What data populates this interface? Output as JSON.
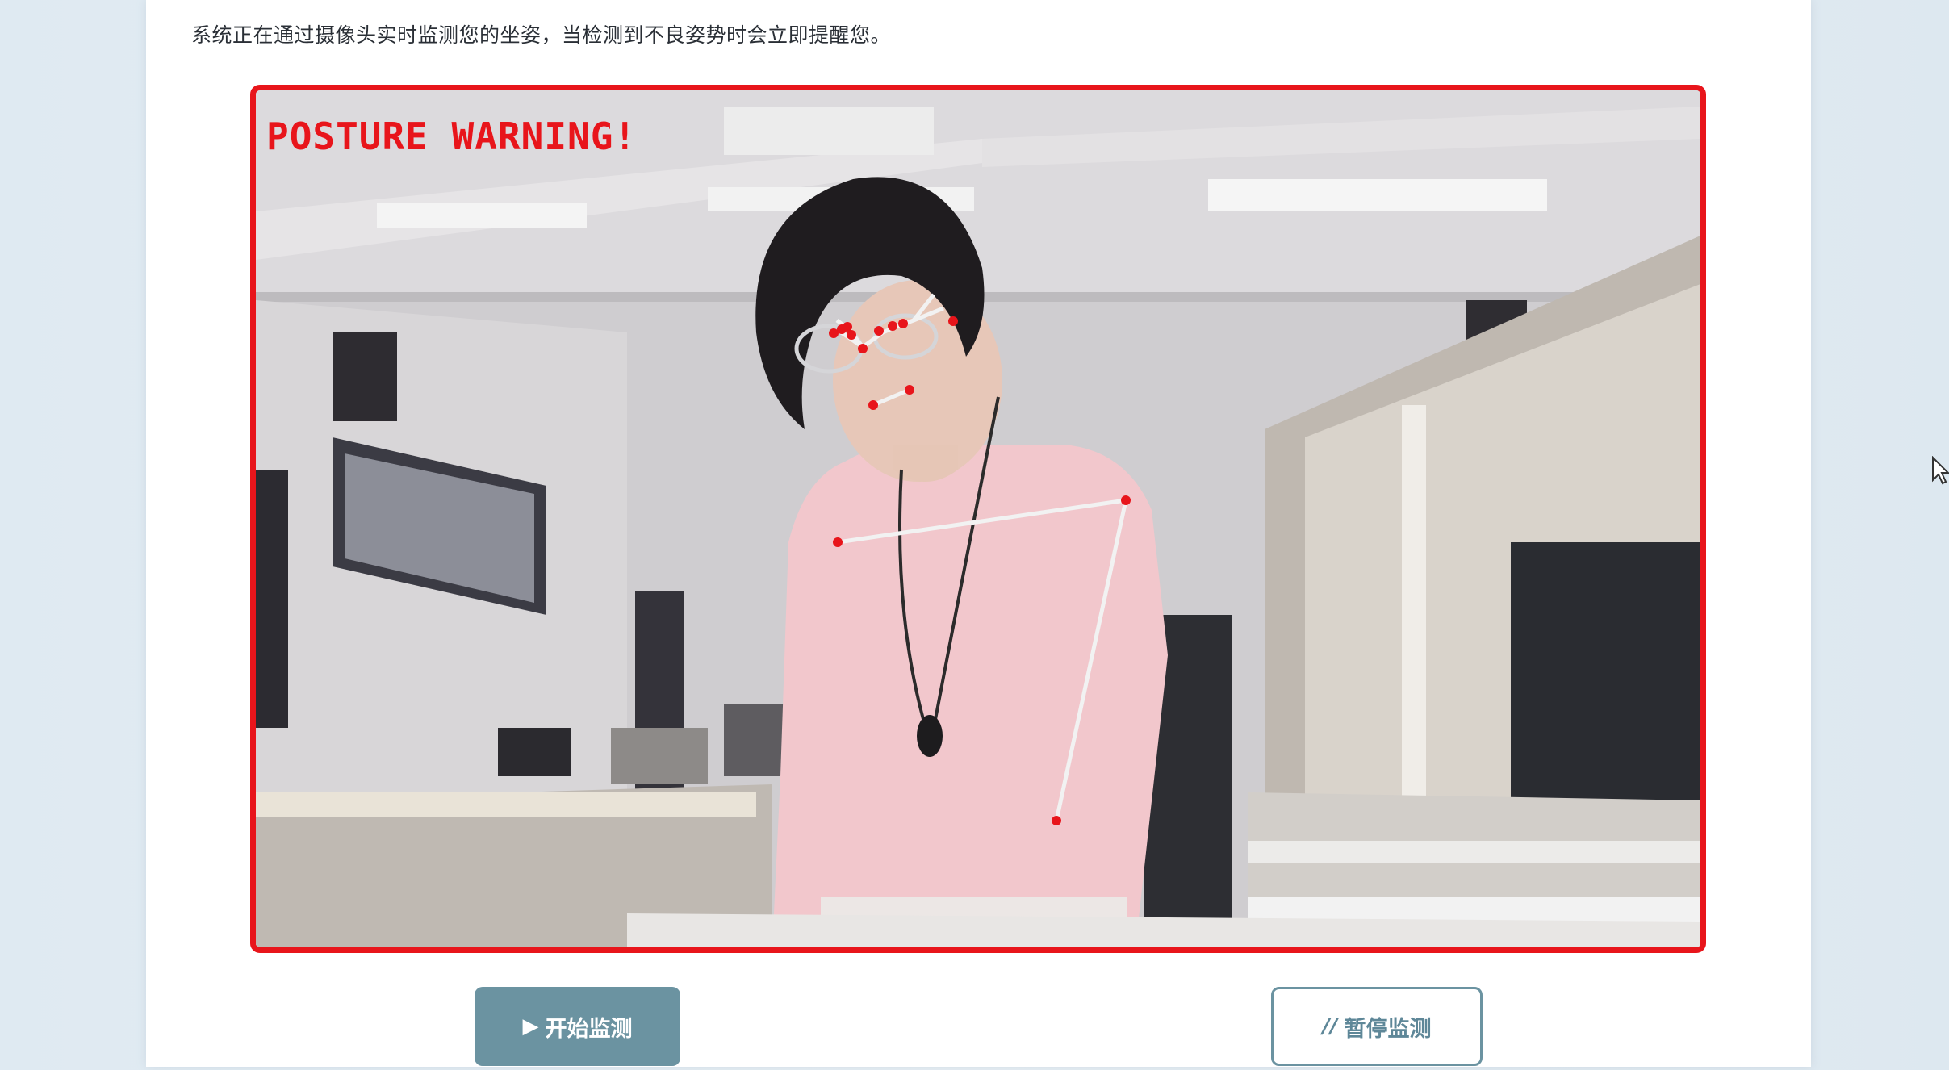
{
  "description": "系统正在通过摄像头实时监测您的坐姿，当检测到不良姿势时会立即提醒您。",
  "video": {
    "overlay_text": "POSTURE WARNING!",
    "border_color": "#e8151b",
    "keypoint_color": "#e8151b",
    "skeleton_color": "#f2f2f2"
  },
  "buttons": {
    "start": {
      "icon": "▶",
      "label": "开始监测"
    },
    "pause": {
      "icon": "//",
      "label": "暂停监测"
    }
  },
  "colors": {
    "start_bg": "#6b93a1",
    "pause_border": "#6b93a1",
    "panel_bg": "#ffffff"
  }
}
